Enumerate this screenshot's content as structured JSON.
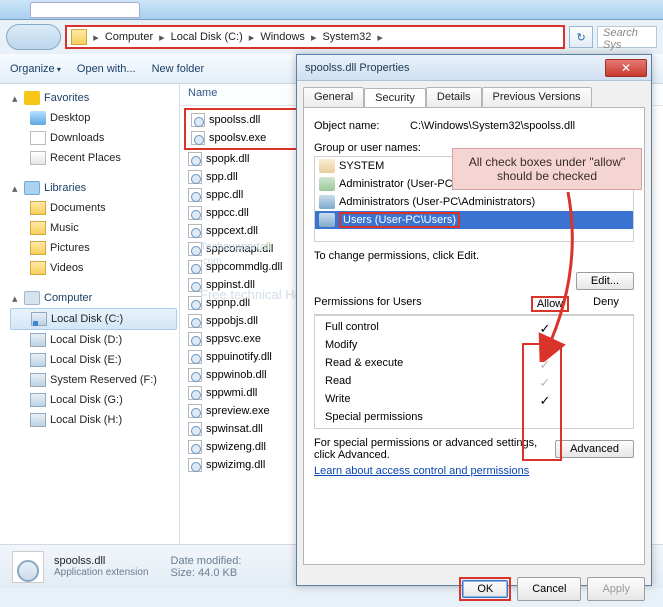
{
  "breadcrumb": {
    "segs": [
      "Computer",
      "Local Disk (C:)",
      "Windows",
      "System32"
    ],
    "search_placeholder": "Search Sys"
  },
  "toolbar": {
    "organize": "Organize",
    "openwith": "Open with...",
    "newfolder": "New folder"
  },
  "nav": {
    "favorites": {
      "label": "Favorites",
      "items": [
        "Desktop",
        "Downloads",
        "Recent Places"
      ]
    },
    "libraries": {
      "label": "Libraries",
      "items": [
        "Documents",
        "Music",
        "Pictures",
        "Videos"
      ]
    },
    "computer": {
      "label": "Computer",
      "items": [
        "Local Disk (C:)",
        "Local Disk (D:)",
        "Local Disk (E:)",
        "System Reserved (F:)",
        "Local Disk (G:)",
        "Local Disk (H:)"
      ]
    }
  },
  "filehead": "Name",
  "files_highlighted": [
    "spoolss.dll",
    "spoolsv.exe"
  ],
  "files": [
    "spopk.dll",
    "spp.dll",
    "sppc.dll",
    "sppcc.dll",
    "sppcext.dll",
    "sppcomapi.dll",
    "sppcommdlg.dll",
    "sppinst.dll",
    "sppnp.dll",
    "sppobjs.dll",
    "sppsvc.exe",
    "sppuinotify.dll",
    "sppwinob.dll",
    "sppwmi.dll",
    "spreview.exe",
    "spwinsat.dll",
    "spwizeng.dll",
    "spwizimg.dll"
  ],
  "watermark": {
    "brand_a": "Techsupport",
    "brand_b": "all",
    "dom": ".com",
    "tag": "Free technical Help center"
  },
  "status": {
    "filename": "spoolss.dll",
    "filetype": "Application extension",
    "datemod_label": "Date modified:",
    "size_label": "Size:",
    "size_val": "44.0 KB"
  },
  "dialog": {
    "title": "spoolss.dll Properties",
    "tabs": [
      "General",
      "Security",
      "Details",
      "Previous Versions"
    ],
    "objname_label": "Object name:",
    "objname": "C:\\Windows\\System32\\spoolss.dll",
    "group_label": "Group or user names:",
    "groups": [
      {
        "name": "SYSTEM",
        "ico": "sys"
      },
      {
        "name": "Administrator (User-PC\\Administrator)",
        "ico": "adm"
      },
      {
        "name": "Administrators (User-PC\\Administrators)",
        "ico": "adms"
      },
      {
        "name": "Users (User-PC\\Users)",
        "ico": "usr",
        "sel": true
      }
    ],
    "changeperm": "To change permissions, click Edit.",
    "edit": "Edit...",
    "perm_label": "Permissions for Users",
    "allow": "Allow",
    "deny": "Deny",
    "perms": [
      {
        "name": "Full control",
        "allow": true,
        "strong": true
      },
      {
        "name": "Modify",
        "allow": true,
        "strong": true
      },
      {
        "name": "Read & execute",
        "allow": true,
        "strong": false
      },
      {
        "name": "Read",
        "allow": true,
        "strong": false
      },
      {
        "name": "Write",
        "allow": true,
        "strong": true
      },
      {
        "name": "Special permissions",
        "allow": false,
        "strong": false
      }
    ],
    "advtext": "For special permissions or advanced settings, click Advanced.",
    "advanced": "Advanced",
    "learn": "Learn about access control and permissions",
    "ok": "OK",
    "cancel": "Cancel",
    "apply": "Apply"
  },
  "callout": "All check boxes under \"allow\" should be checked"
}
